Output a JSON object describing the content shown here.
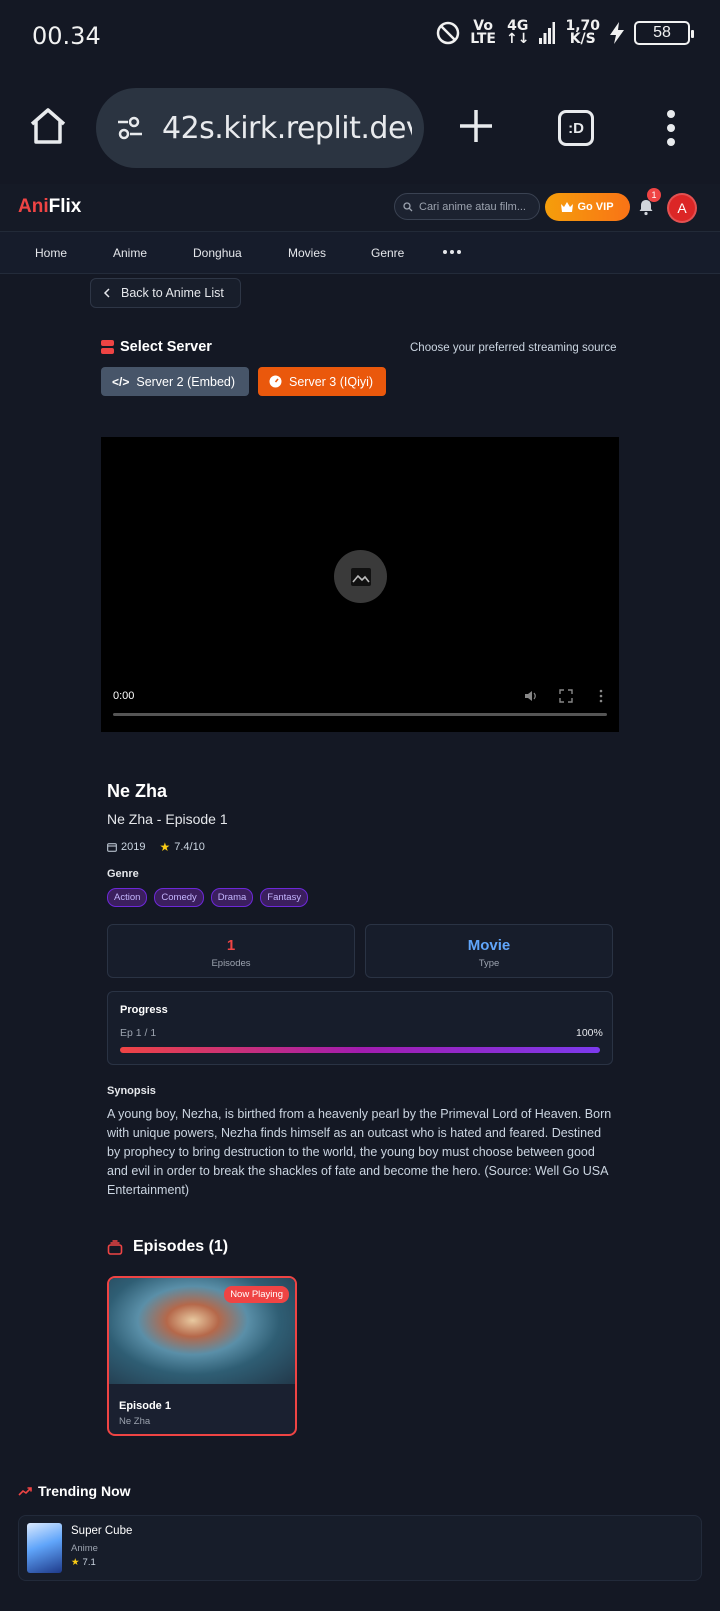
{
  "status_bar": {
    "time": "00.34",
    "volte": [
      "Vo",
      "LTE"
    ],
    "net": [
      "4G",
      "↑↓"
    ],
    "speed": [
      "1,70",
      "K/S"
    ],
    "battery": "58"
  },
  "browser": {
    "url": "42s.kirk.replit.dev",
    "tabs_label": ":D"
  },
  "header": {
    "logo_red": "Ani",
    "logo_white": "Flix",
    "search_placeholder": "Cari anime atau film...",
    "vip_label": "Go VIP",
    "notif_count": "1",
    "avatar_initial": "A"
  },
  "nav": {
    "items": [
      "Home",
      "Anime",
      "Donghua",
      "Movies",
      "Genre"
    ]
  },
  "back_label": "Back to Anime List",
  "server": {
    "title": "Select Server",
    "hint": "Choose your preferred streaming source",
    "options": [
      "Server 2 (Embed)",
      "Server 3 (IQiyi)"
    ],
    "selected": "Server 3 (IQiyi)"
  },
  "player": {
    "time": "0:00",
    "progress": 0
  },
  "anime": {
    "title": "Ne Zha",
    "subtitle": "Ne Zha - Episode 1",
    "year": "2019",
    "rating": "7.4/10",
    "genre_label": "Genre",
    "genres": [
      "Action",
      "Comedy",
      "Drama",
      "Fantasy"
    ],
    "stats": [
      {
        "value": "1",
        "label": "Episodes",
        "color": "#ef4444"
      },
      {
        "value": "Movie",
        "label": "Type",
        "color": "#60a5fa"
      }
    ],
    "progress": {
      "title": "Progress",
      "episode_text": "Ep 1 / 1",
      "percent_text": "100%",
      "percent": 100
    },
    "synopsis_label": "Synopsis",
    "synopsis": "A young boy, Nezha, is birthed from a heavenly pearl by the Primeval Lord of Heaven. Born with unique powers, Nezha finds himself as an outcast who is hated and feared. Destined by prophecy to bring destruction to the world, the young boy must choose between good and evil in order to break the shackles of fate and become the hero. (Source: Well Go USA Entertainment)"
  },
  "episodes": {
    "heading": "Episodes (1)",
    "items": [
      {
        "title": "Episode 1",
        "subtitle": "Ne Zha",
        "badge": "Now Playing"
      }
    ]
  },
  "trending": {
    "heading": "Trending Now",
    "items": [
      {
        "title": "Super Cube",
        "type": "Anime",
        "rating": "7.1"
      }
    ]
  },
  "colors": {
    "accent": "#ef4444",
    "vip": "#f59e0b",
    "server_active": "#ea580c",
    "server_inactive": "#475569",
    "tag": "#c4b5fd"
  }
}
